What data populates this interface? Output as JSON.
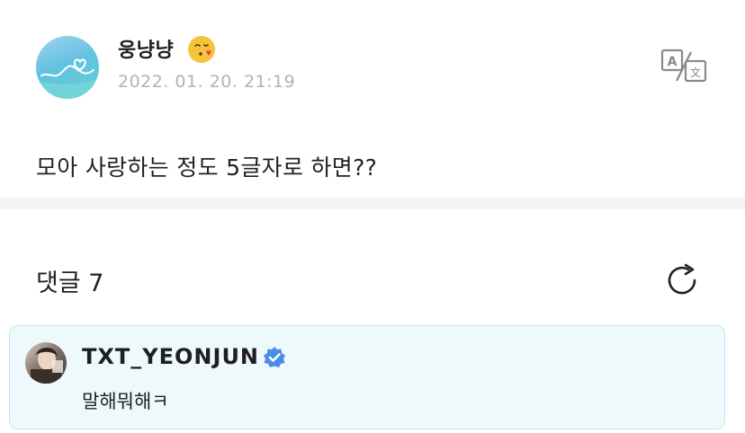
{
  "post": {
    "author": "웅냥냥",
    "author_emoji": "face-blowing-a-kiss-emoji",
    "date": "2022. 01. 20. 21:19",
    "body": "모아 사랑하는 정도 5글자로 하면??"
  },
  "comments": {
    "title": "댓글 7",
    "items": [
      {
        "author": "TXT_YEONJUN",
        "text": "말해뭐해ㅋ"
      }
    ]
  },
  "colors": {
    "accent_verified": "#4a8ce8",
    "comment_bg": "#eef9fc",
    "comment_border": "#bfe6f0",
    "date_gray": "#b3b3b3"
  },
  "icons": [
    "translate-icon",
    "refresh-icon",
    "verified-badge-icon"
  ]
}
